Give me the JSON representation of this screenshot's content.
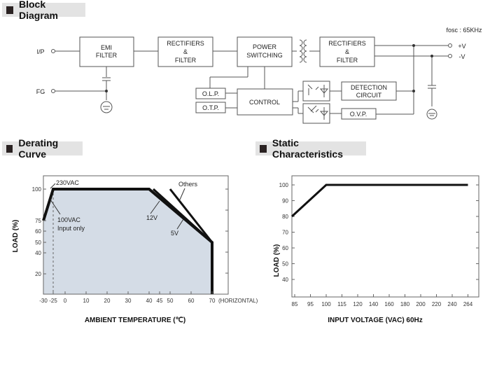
{
  "block_diagram": {
    "title": "Block Diagram",
    "fosc": "fosc : 65KHz",
    "terminals": {
      "ip": "I/P",
      "fg": "FG",
      "plus_v": "+V",
      "minus_v": "-V"
    },
    "blocks": {
      "emi": [
        "EMI",
        "FILTER"
      ],
      "rect1": [
        "RECTIFIERS",
        "&",
        "FILTER"
      ],
      "power": [
        "POWER",
        "SWITCHING"
      ],
      "rect2": [
        "RECTIFIERS",
        "&",
        "FILTER"
      ],
      "olp": "O.L.P.",
      "otp": "O.T.P.",
      "control": "CONTROL",
      "detection": [
        "DETECTION",
        "CIRCUIT"
      ],
      "ovp": "O.V.P."
    }
  },
  "derating": {
    "title": "Derating Curve",
    "ylabel": "LOAD (%)",
    "xlabel": "AMBIENT TEMPERATURE (℃)",
    "x_suffix": "(HORIZONTAL)",
    "annotations": {
      "a230": "230VAC",
      "a100": "100VAC",
      "a100b": "Input only",
      "others": "Others",
      "v12": "12V",
      "v5": "5V"
    }
  },
  "static": {
    "title": "Static Characteristics",
    "ylabel": "LOAD (%)",
    "xlabel": "INPUT VOLTAGE (VAC) 60Hz"
  },
  "chart_data": [
    {
      "type": "line",
      "title": "Derating Curve",
      "xlabel": "AMBIENT TEMPERATURE (℃)",
      "ylabel": "LOAD (%)",
      "x_ticks": [
        -30,
        -25,
        0,
        10,
        20,
        30,
        40,
        45,
        50,
        60,
        70
      ],
      "x_tick_labels": [
        "-30",
        "-25",
        "0",
        "10",
        "20",
        "30",
        "40",
        "45",
        "50",
        "60",
        "70"
      ],
      "y_ticks": [
        20,
        40,
        50,
        60,
        75,
        100
      ],
      "xlim": [
        -30,
        80
      ],
      "ylim": [
        0,
        110
      ],
      "series": [
        {
          "name": "230VAC / 100VAC",
          "x": [
            -30,
            -25,
            40,
            70,
            70
          ],
          "y": [
            75,
            100,
            100,
            50,
            0
          ]
        },
        {
          "name": "12V",
          "x": [
            42,
            70
          ],
          "y": [
            100,
            50
          ]
        },
        {
          "name": "Others",
          "x": [
            50,
            70
          ],
          "y": [
            100,
            50
          ]
        },
        {
          "name": "5V",
          "x": [
            40,
            70
          ],
          "y": [
            100,
            50
          ]
        }
      ],
      "reference_line": {
        "name": "100VAC Input only",
        "x": -25
      },
      "grid": false,
      "fill_under": true
    },
    {
      "type": "line",
      "title": "Static Characteristics",
      "xlabel": "INPUT VOLTAGE (VAC) 60Hz",
      "ylabel": "LOAD (%)",
      "x_ticks": [
        "85",
        "95",
        "100",
        "115",
        "120",
        "140",
        "160",
        "180",
        "200",
        "220",
        "240",
        "264"
      ],
      "y_ticks": [
        40,
        50,
        60,
        70,
        80,
        90,
        100
      ],
      "ylim": [
        30,
        105
      ],
      "series": [
        {
          "name": "Load",
          "x": [
            "85",
            "100",
            "264"
          ],
          "y": [
            80,
            100,
            100
          ]
        }
      ],
      "grid": false
    }
  ]
}
